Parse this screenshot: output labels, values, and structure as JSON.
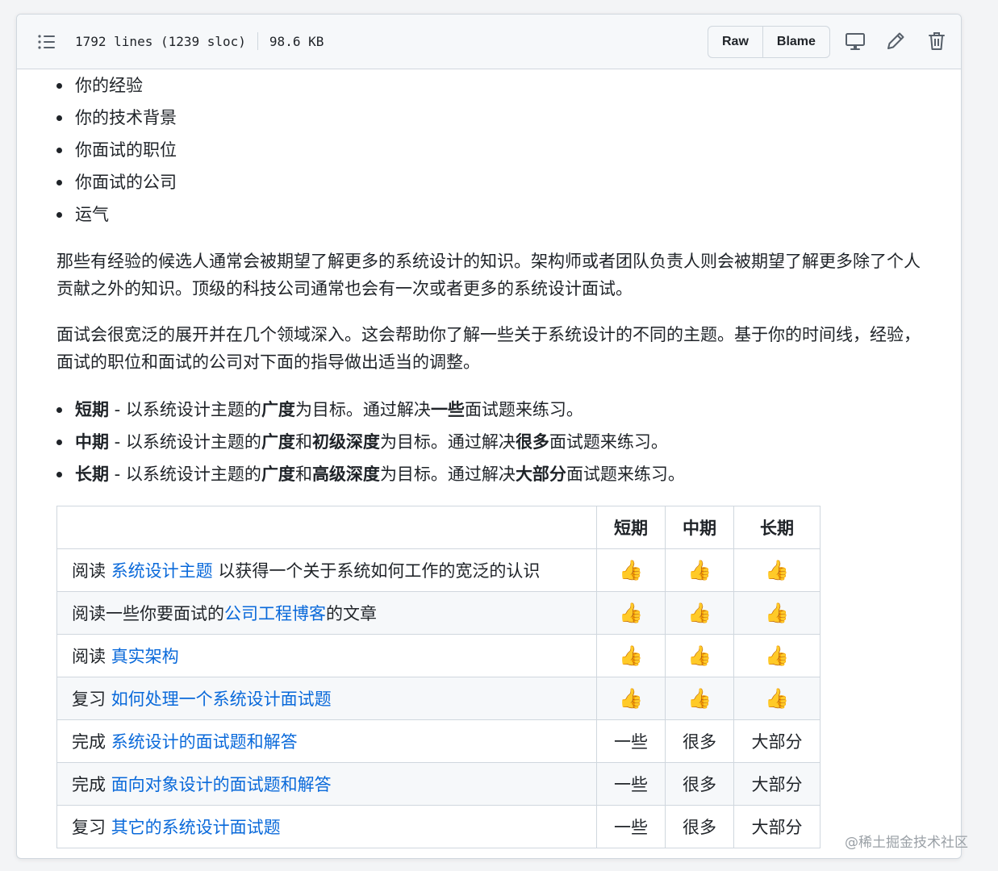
{
  "toolbar": {
    "lines": "1792 lines (1239 sloc)",
    "size": "98.6 KB",
    "raw_label": "Raw",
    "blame_label": "Blame",
    "icons": [
      "list-icon",
      "desktop-icon",
      "pencil-icon",
      "trash-icon"
    ]
  },
  "factors": [
    "你的经验",
    "你的技术背景",
    "你面试的职位",
    "你面试的公司",
    "运气"
  ],
  "para1": "那些有经验的候选人通常会被期望了解更多的系统设计的知识。架构师或者团队负责人则会被期望了解更多除了个人贡献之外的知识。顶级的科技公司通常也会有一次或者更多的系统设计面试。",
  "para2": "面试会很宽泛的展开并在几个领域深入。这会帮助你了解一些关于系统设计的不同的主题。基于你的时间线，经验，面试的职位和面试的公司对下面的指导做出适当的调整。",
  "plans": [
    {
      "term": "短期",
      "sep": " - 以系统设计主题的",
      "b1": "广度",
      "t1": "为目标。通过解决",
      "b2": "一些",
      "t2": "面试题来练习。"
    },
    {
      "term": "中期",
      "sep": " - 以系统设计主题的",
      "b1": "广度",
      "and": "和",
      "b1b": "初级深度",
      "t1": "为目标。通过解决",
      "b2": "很多",
      "t2": "面试题来练习。"
    },
    {
      "term": "长期",
      "sep": " - 以系统设计主题的",
      "b1": "广度",
      "and": "和",
      "b1b": "高级深度",
      "t1": "为目标。通过解决",
      "b2": "大部分",
      "t2": "面试题来练习。"
    }
  ],
  "table": {
    "headers": [
      "",
      "短期",
      "中期",
      "长期"
    ],
    "rows": [
      {
        "pre": "阅读 ",
        "link": "系统设计主题",
        "post": " 以获得一个关于系统如何工作的宽泛的认识",
        "cells": [
          "👍",
          "👍",
          "👍"
        ]
      },
      {
        "pre": "阅读一些你要面试的",
        "link": "公司工程博客",
        "post": "的文章",
        "cells": [
          "👍",
          "👍",
          "👍"
        ]
      },
      {
        "pre": "阅读 ",
        "link": "真实架构",
        "post": "",
        "cells": [
          "👍",
          "👍",
          "👍"
        ]
      },
      {
        "pre": "复习 ",
        "link": "如何处理一个系统设计面试题",
        "post": "",
        "cells": [
          "👍",
          "👍",
          "👍"
        ]
      },
      {
        "pre": "完成 ",
        "link": "系统设计的面试题和解答",
        "post": "",
        "cells": [
          "一些",
          "很多",
          "大部分"
        ]
      },
      {
        "pre": "完成 ",
        "link": "面向对象设计的面试题和解答",
        "post": "",
        "cells": [
          "一些",
          "很多",
          "大部分"
        ]
      },
      {
        "pre": "复习 ",
        "link": "其它的系统设计面试题",
        "post": "",
        "cells": [
          "一些",
          "很多",
          "大部分"
        ]
      }
    ]
  },
  "watermark": "@稀土掘金技术社区",
  "colors": {
    "link": "#0969da",
    "border": "#d0d7de",
    "toolbar_bg": "#f6f8fa"
  }
}
